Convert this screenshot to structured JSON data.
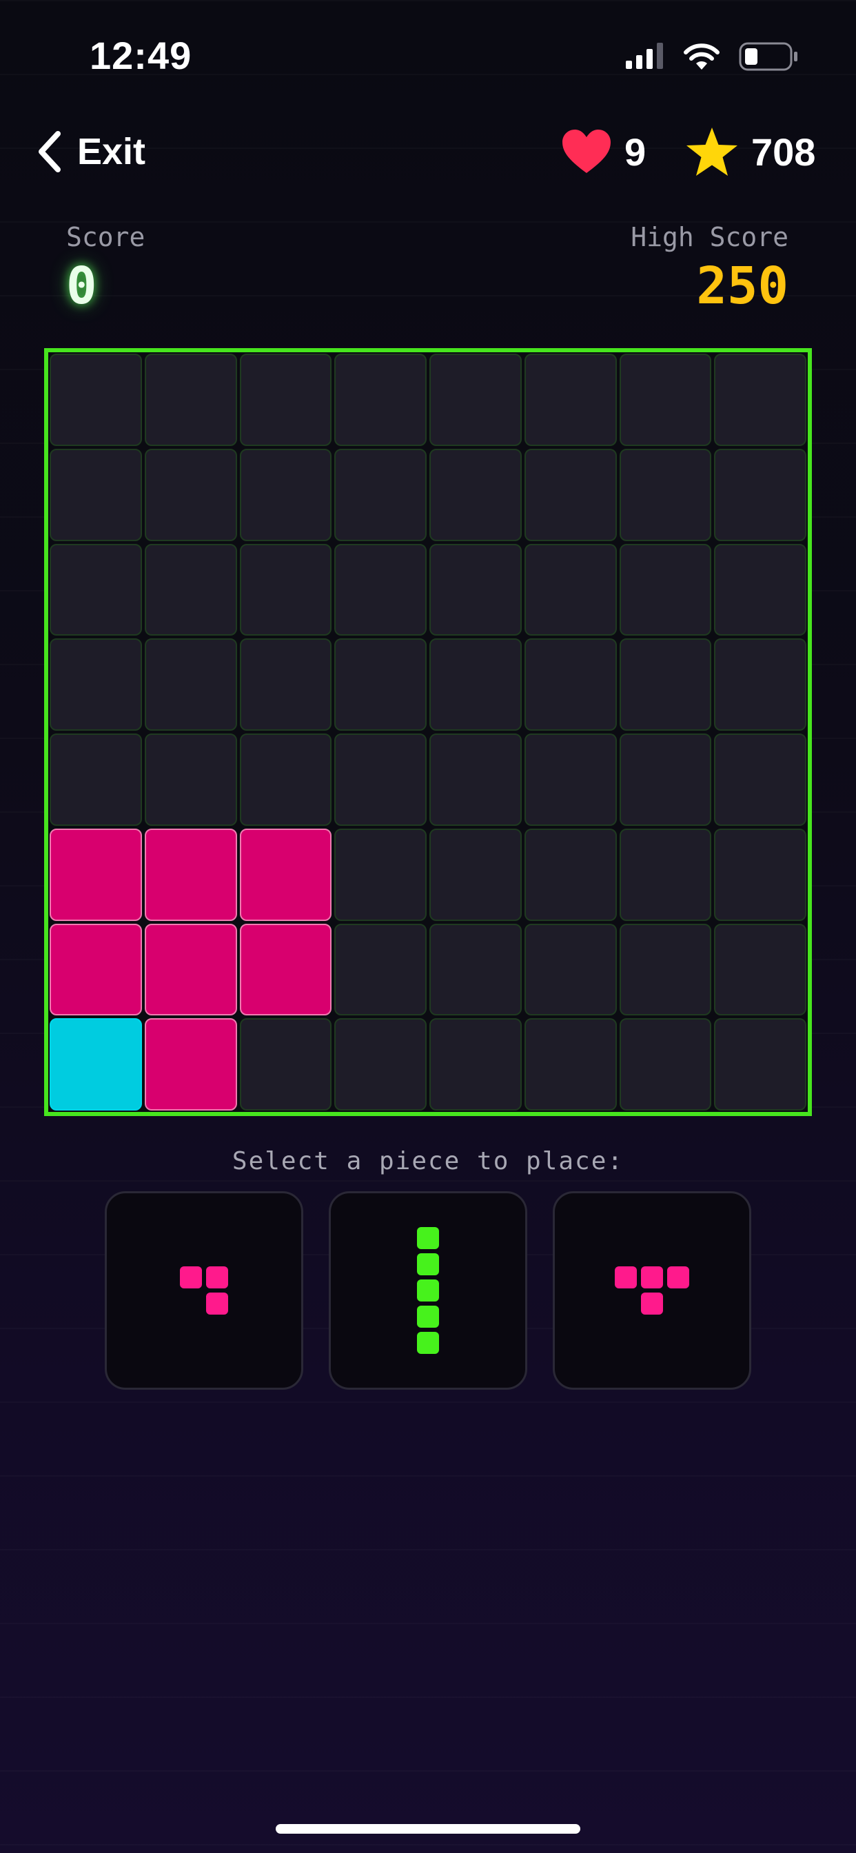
{
  "status_bar": {
    "time": "12:49"
  },
  "header": {
    "exit_label": "Exit",
    "lives": "9",
    "stars": "708"
  },
  "scores": {
    "score_label": "Score",
    "score_value": "0",
    "high_label": "High Score",
    "high_value": "250"
  },
  "colors": {
    "board_border": "#47e51e",
    "magenta": "#d8006e",
    "cyan": "#00cce0",
    "green_piece": "#47f21c",
    "pink_piece": "#ff1a8c",
    "heart": "#ff2d55",
    "star": "#ffd60a"
  },
  "board": {
    "size": 8,
    "rows": [
      [
        "",
        "",
        "",
        "",
        "",
        "",
        "",
        ""
      ],
      [
        "",
        "",
        "",
        "",
        "",
        "",
        "",
        ""
      ],
      [
        "",
        "",
        "",
        "",
        "",
        "",
        "",
        ""
      ],
      [
        "",
        "",
        "",
        "",
        "",
        "",
        "",
        ""
      ],
      [
        "",
        "",
        "",
        "",
        "",
        "",
        "",
        ""
      ],
      [
        "magenta",
        "magenta",
        "magenta",
        "",
        "",
        "",
        "",
        ""
      ],
      [
        "magenta",
        "magenta",
        "magenta",
        "",
        "",
        "",
        "",
        ""
      ],
      [
        "cyan",
        "magenta",
        "",
        "",
        "",
        "",
        "",
        ""
      ]
    ]
  },
  "piece_selector": {
    "prompt": "Select a piece to place:",
    "pieces": [
      {
        "name": "pink-corner-piece",
        "color": "pink",
        "cells": [
          [
            0,
            0
          ],
          [
            0,
            1
          ],
          [
            1,
            1
          ]
        ]
      },
      {
        "name": "green-vertical-piece",
        "color": "green",
        "cells": [
          [
            0,
            0
          ],
          [
            1,
            0
          ],
          [
            2,
            0
          ],
          [
            3,
            0
          ],
          [
            4,
            0
          ]
        ]
      },
      {
        "name": "pink-t-piece",
        "color": "pink",
        "cells": [
          [
            0,
            0
          ],
          [
            0,
            1
          ],
          [
            0,
            2
          ],
          [
            1,
            1
          ]
        ]
      }
    ]
  }
}
